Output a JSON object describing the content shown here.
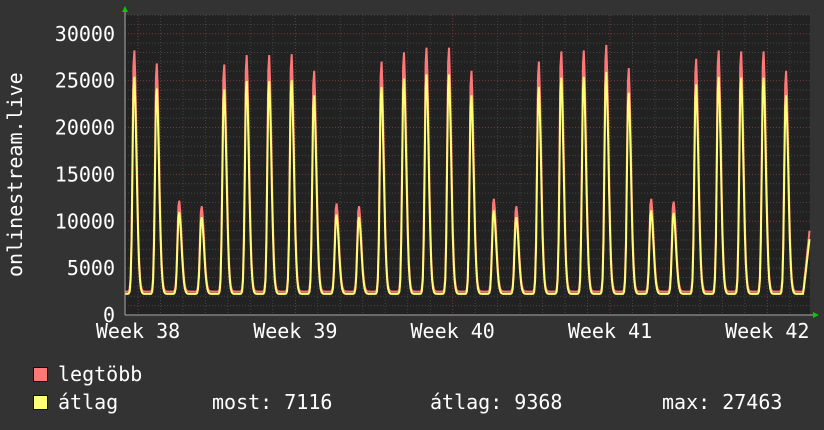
{
  "chart_data": {
    "type": "line",
    "ylabel": "onlinestream.live",
    "ylim": [
      0,
      32000
    ],
    "yticks": [
      0,
      5000,
      10000,
      15000,
      20000,
      25000,
      30000
    ],
    "xticks": [
      "Week 38",
      "Week 39",
      "Week 40",
      "Week 41",
      "Week 42"
    ],
    "xlim_days": [
      -0.58,
      29.9
    ],
    "daily_peaks_max": [
      28500,
      27100,
      12300,
      11700,
      27000,
      28000,
      28000,
      28100,
      26300,
      12000,
      11700,
      27300,
      28300,
      28800,
      28800,
      26300,
      12500,
      11700,
      27300,
      28400,
      28500,
      29100,
      26600,
      12500,
      12200,
      27600,
      28500,
      28400,
      28400,
      26300
    ],
    "daily_min": 2500,
    "last_value_max": 9500,
    "series": [
      {
        "name": "legtöbb",
        "color": "#ff7777"
      },
      {
        "name": "átlag",
        "color": "#ffff77"
      }
    ],
    "grid": true
  },
  "legend": {
    "max_label": "legtöbb",
    "avg_label": "átlag",
    "now": "most: 7116",
    "avg": "átlag: 9368",
    "max": "max: 27463"
  }
}
